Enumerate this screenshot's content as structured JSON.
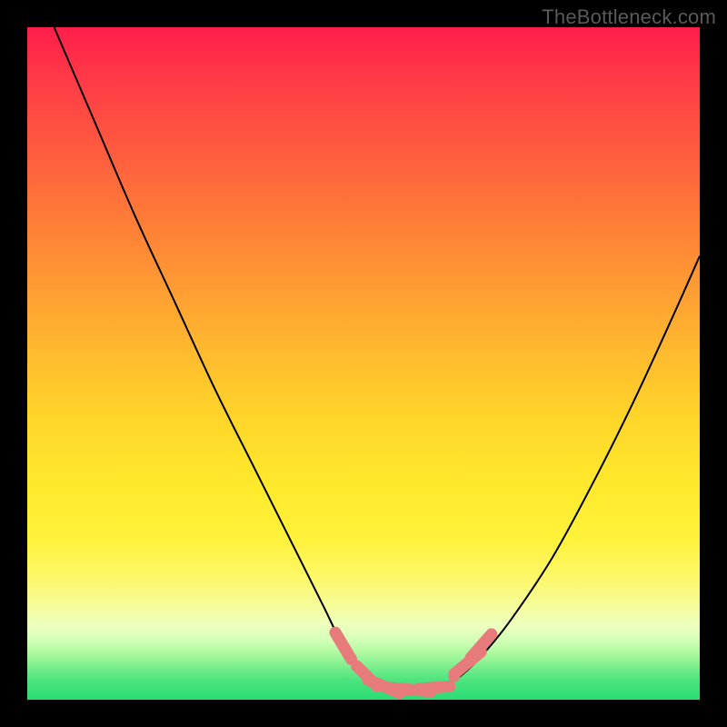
{
  "watermark": "TheBottleneck.com",
  "colors": {
    "frame": "#000000",
    "curve": "#000000",
    "marker": "#e77a7a",
    "gradient_top": "#ff1e4a",
    "gradient_bottom": "#2adc74"
  },
  "chart_data": {
    "type": "line",
    "title": "",
    "xlabel": "",
    "ylabel": "",
    "xlim": [
      0,
      100
    ],
    "ylim": [
      0,
      100
    ],
    "note": "x is normalized horizontal position (0=left edge of plot, 100=right). y is normalized bottleneck/mismatch percentage (0=bottom/green/optimal, 100=top/red/severe). Curve is a V / check-mark shape with a flat optimal basin near x≈52–62.",
    "series": [
      {
        "name": "bottleneck-curve",
        "x": [
          4,
          10,
          16,
          22,
          28,
          34,
          40,
          44,
          47,
          50,
          53,
          56,
          59,
          62,
          65,
          68,
          72,
          78,
          84,
          90,
          96,
          100
        ],
        "y": [
          100,
          86,
          72,
          59,
          46,
          34,
          22,
          14,
          8,
          4,
          2,
          1.5,
          1.5,
          2,
          4,
          7,
          12,
          21,
          32,
          44,
          57,
          66
        ]
      }
    ],
    "markers": {
      "note": "Salmon lozenge/dot markers clustered around the basin of the curve.",
      "points": [
        {
          "x": 47.0,
          "y": 8.0,
          "shape": "lozenge",
          "len": 3.0
        },
        {
          "x": 49.0,
          "y": 5.0,
          "shape": "dot"
        },
        {
          "x": 50.5,
          "y": 3.5,
          "shape": "lozenge",
          "len": 2.5
        },
        {
          "x": 53.0,
          "y": 2.0,
          "shape": "lozenge",
          "len": 3.5
        },
        {
          "x": 57.0,
          "y": 1.5,
          "shape": "lozenge",
          "len": 4.5
        },
        {
          "x": 60.5,
          "y": 1.8,
          "shape": "lozenge",
          "len": 3.0
        },
        {
          "x": 63.5,
          "y": 3.5,
          "shape": "dot"
        },
        {
          "x": 65.5,
          "y": 5.5,
          "shape": "lozenge",
          "len": 3.5
        },
        {
          "x": 67.5,
          "y": 8.0,
          "shape": "lozenge",
          "len": 3.0
        }
      ]
    }
  }
}
